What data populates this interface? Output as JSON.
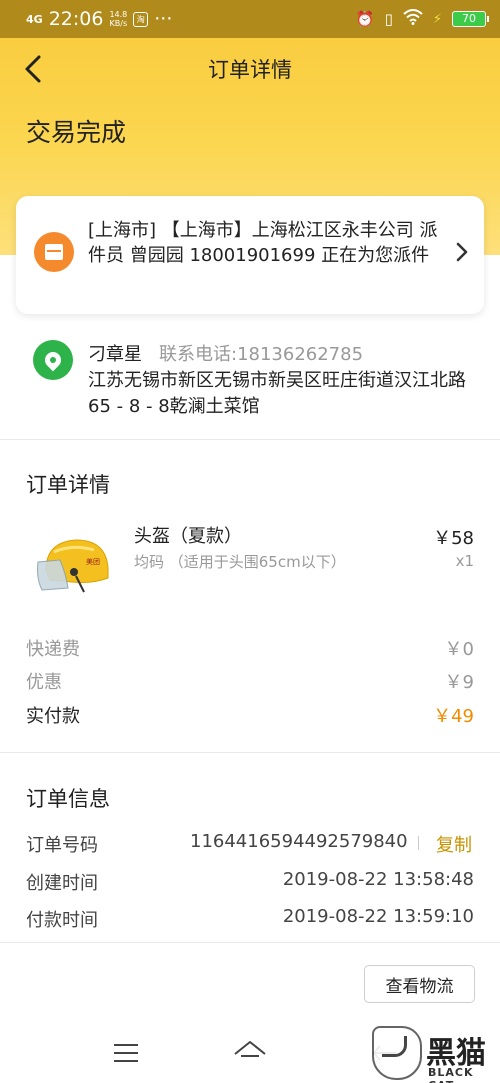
{
  "status_bar": {
    "signal": "4G",
    "time": "22:06",
    "net_speed": "14.8",
    "net_unit": "KB/s",
    "app_badge": "淘",
    "more": "···",
    "battery": "70"
  },
  "nav": {
    "title": "订单详情"
  },
  "order_status": "交易完成",
  "logistics": {
    "text": "[上海市] 【上海市】上海松江区永丰公司 派件员 曾园园 18001901699 正在为您派件"
  },
  "address": {
    "name": "刁章星",
    "phone": "联系电话:18136262785",
    "detail": "江苏无锡市新区无锡市新吴区旺庄街道汉江北路65 - 8 - 8乾澜土菜馆"
  },
  "order_detail": {
    "title": "订单详情",
    "product": {
      "name": "头盔（夏款）",
      "spec": "均码 （适用于头围65cm以下）",
      "price": "￥58",
      "qty": "x1"
    },
    "shipping_label": "快递费",
    "shipping_value": "￥0",
    "discount_label": "优惠",
    "discount_value": "￥9",
    "paid_label": "实付款",
    "paid_value": "￥49"
  },
  "order_info": {
    "title": "订单信息",
    "number_label": "订单号码",
    "number_value": "1164416594492579840",
    "copy_label": "复制",
    "created_label": "创建时间",
    "created_value": "2019-08-22 13:58:48",
    "paid_label": "付款时间",
    "paid_value": "2019-08-22 13:59:10"
  },
  "actions": {
    "logistics_button": "查看物流"
  },
  "watermark": {
    "text": "黑猫",
    "sub": "BLACK CAT"
  },
  "colors": {
    "header_yellow": "#fbd64f",
    "accent_orange": "#f08c00",
    "copy_gold": "#c79300",
    "box_icon_orange": "#f58a2c",
    "pin_icon_green": "#2db34a",
    "battery_green": "#3dcc4a"
  }
}
